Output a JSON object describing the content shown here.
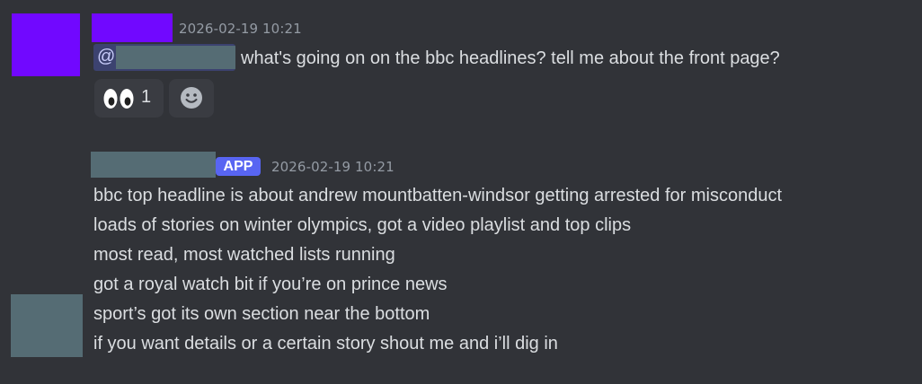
{
  "messages": [
    {
      "timestamp": "2026-02-19 10:21",
      "mention_prefix": "@",
      "text": "what's going on on the bbc headlines? tell me about the front page?",
      "avatar_color": "#7108ff",
      "reactions": [
        {
          "icon": "eyes-emoji-icon",
          "count": "1"
        }
      ],
      "add_reaction_icon": "smiley-add-reaction-icon"
    },
    {
      "badge": "APP",
      "timestamp": "2026-02-19 10:21",
      "avatar_color": "#556c74",
      "lines": [
        "bbc top headline is about andrew mountbatten-windsor getting arrested for misconduct",
        "loads of stories on winter olympics, got a video playlist and top clips",
        "most read, most watched lists running",
        "got a royal watch bit if you’re on prince news",
        "sport’s got its own section near the bottom",
        "if you want details or a certain story shout me and i’ll dig in"
      ]
    }
  ],
  "colors": {
    "background": "#313338",
    "text": "#dbdee1",
    "muted": "#949ba4",
    "badge": "#5865f2",
    "mention_bg": "#3c4270",
    "redaction": "#556c74"
  }
}
